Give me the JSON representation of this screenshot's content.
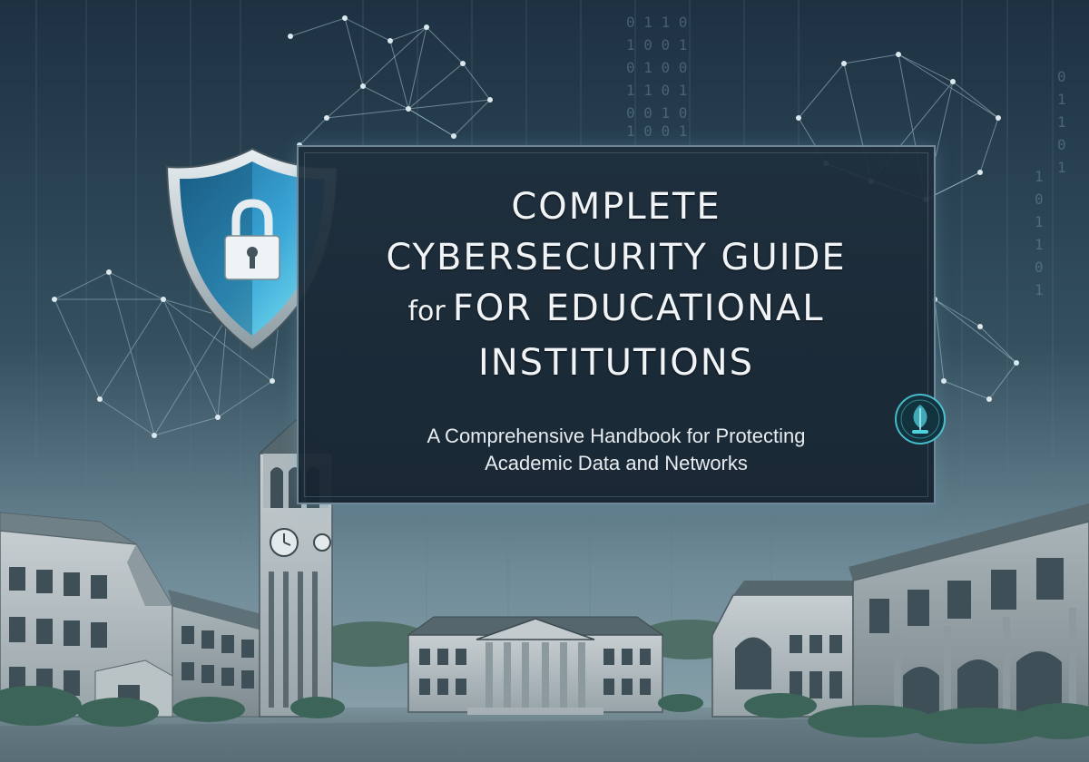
{
  "title": {
    "line1": "COMPLETE",
    "line2": "CYBERSECURITY GUIDE",
    "line3_prefix": "for",
    "line3": "FOR EDUCATIONAL",
    "line4": "INSTITUTIONS"
  },
  "subtitle": {
    "line1": "A Comprehensive Handbook for Protecting",
    "line2": "Academic Data and Networks"
  },
  "icons": {
    "shield": "shield-lock-icon",
    "badge": "leaf-badge-icon"
  },
  "colors": {
    "panel_bg": "#1e2e3c",
    "shield_blue": "#3aa7d8",
    "accent_glow": "#4fd2e0",
    "text": "#f1f4f6",
    "sky_top": "#22394a",
    "sky_bottom": "#6f8a99"
  }
}
